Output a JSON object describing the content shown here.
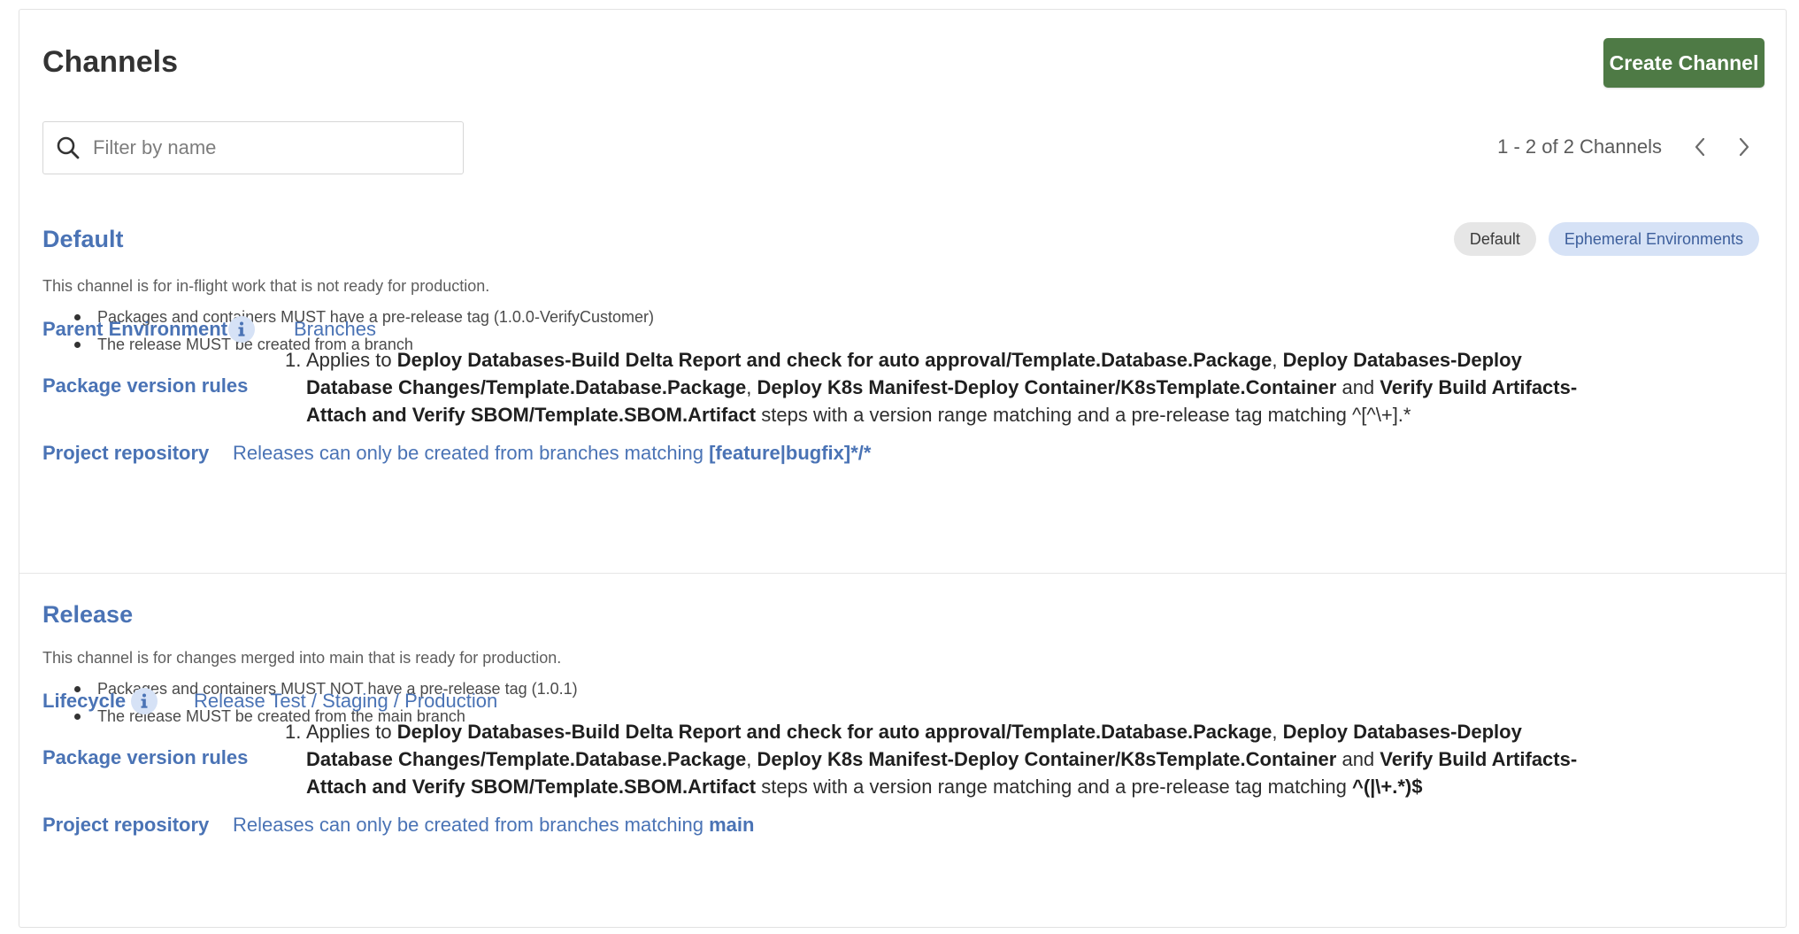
{
  "page": {
    "title": "Channels",
    "create_button": "Create Channel"
  },
  "search": {
    "placeholder": "Filter by name",
    "value": ""
  },
  "pagination": {
    "text": "1 - 2 of 2 Channels"
  },
  "icons": {
    "search": "search-icon",
    "prev": "chevron-left-icon",
    "next": "chevron-right-icon",
    "info": "info-icon"
  },
  "colors": {
    "accent": "#4a73b5",
    "primary_button": "#4e7a45",
    "tag_grey": "#e6e6e6",
    "tag_blue": "#d6e2f6"
  },
  "channels": [
    {
      "name": "Default",
      "tags": [
        "Default",
        "Ephemeral Environments"
      ],
      "description": "This channel is for in-flight work that is not ready for production.",
      "bullets": [
        "Packages and containers MUST have a pre-release tag (1.0.0-VerifyCustomer)",
        "The release MUST be created from a branch"
      ],
      "env_label": "Parent Environment",
      "env_value": "Branches",
      "rules_label": "Package version rules",
      "rule": {
        "num": "1.",
        "prefix": "Applies to ",
        "step1": "Deploy Databases-Build Delta Report and check for auto approval/Template.Database.Package",
        "sep1": ", ",
        "step2": "Deploy Databases-Deploy Database Changes/Template.Database.Package",
        "sep2": ", ",
        "step3": "Deploy K8s Manifest-Deploy Container/K8sTemplate.Container",
        "sep3": " and ",
        "step4": "Verify Build Artifacts-Attach and Verify SBOM/Template.SBOM.Artifact",
        "suffix": " steps with a version range matching and a pre-release tag matching ",
        "pattern": "^[^\\+].*"
      },
      "repo_label": "Project repository",
      "repo_prefix": "Releases can only be created from branches matching ",
      "repo_pattern": "[feature|bugfix]*/*"
    },
    {
      "name": "Release",
      "description": "This channel is for changes merged into main that is ready for production.",
      "bullets": [
        "Packages and containers MUST NOT have a pre-release tag (1.0.1)",
        "The release MUST be created from the main branch"
      ],
      "env_label": "Lifecycle",
      "env_value": "Release Test / Staging / Production",
      "rules_label": "Package version rules",
      "rule": {
        "num": "1.",
        "prefix": "Applies to ",
        "step1": "Deploy Databases-Build Delta Report and check for auto approval/Template.Database.Package",
        "sep1": ", ",
        "step2": "Deploy Databases-Deploy Database Changes/Template.Database.Package",
        "sep2": ", ",
        "step3": "Deploy K8s Manifest-Deploy Container/K8sTemplate.Container",
        "sep3": " and ",
        "step4": "Verify Build Artifacts-Attach and Verify SBOM/Template.SBOM.Artifact",
        "suffix": " steps with a version range matching and a pre-release tag matching ",
        "pattern": "^(|\\+.*)$"
      },
      "repo_label": "Project repository",
      "repo_prefix": "Releases can only be created from branches matching ",
      "repo_pattern": "main"
    }
  ]
}
